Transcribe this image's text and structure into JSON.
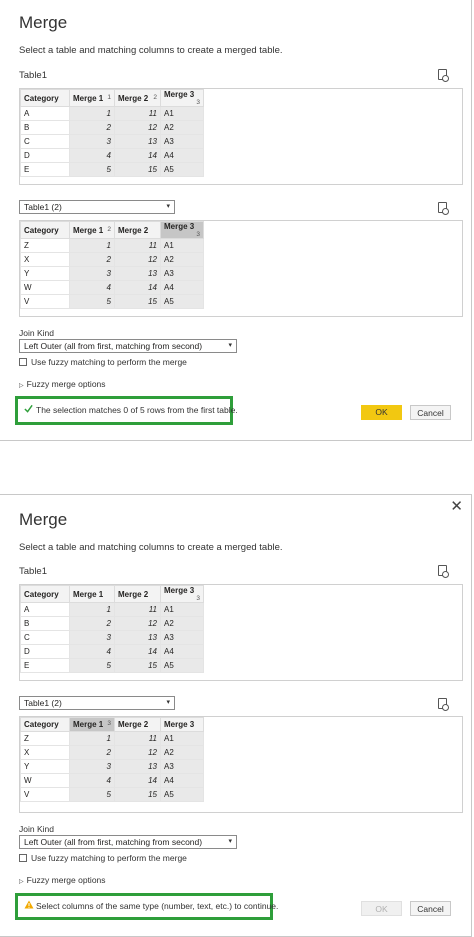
{
  "dialogs": [
    {
      "title": "Merge",
      "description": "Select a table and matching columns to create a merged table.",
      "table1_label": "Table1",
      "table1": {
        "headers": [
          {
            "label": "Category",
            "num": ""
          },
          {
            "label": "Merge 1",
            "num": "1"
          },
          {
            "label": "Merge 2",
            "num": "2"
          },
          {
            "label": "Merge 3",
            "num": "3"
          }
        ],
        "rows": [
          [
            "A",
            "1",
            "11",
            "A1"
          ],
          [
            "B",
            "2",
            "12",
            "A2"
          ],
          [
            "C",
            "3",
            "13",
            "A3"
          ],
          [
            "D",
            "4",
            "14",
            "A4"
          ],
          [
            "E",
            "5",
            "15",
            "A5"
          ]
        ]
      },
      "table2_select": "Table1 (2)",
      "table2": {
        "headers": [
          {
            "label": "Category",
            "num": ""
          },
          {
            "label": "Merge 1",
            "num": "2"
          },
          {
            "label": "Merge 2",
            "num": ""
          },
          {
            "label": "Merge 3",
            "num": "3"
          }
        ],
        "rows": [
          [
            "Z",
            "1",
            "11",
            "A1"
          ],
          [
            "X",
            "2",
            "12",
            "A2"
          ],
          [
            "Y",
            "3",
            "13",
            "A3"
          ],
          [
            "W",
            "4",
            "14",
            "A4"
          ],
          [
            "V",
            "5",
            "15",
            "A5"
          ]
        ]
      },
      "join_kind_label": "Join Kind",
      "join_kind_value": "Left Outer (all from first, matching from second)",
      "fuzzy_checkbox_label": "Use fuzzy matching to perform the merge",
      "fuzzy_options_label": "Fuzzy merge options",
      "status_message": "The selection matches 0 of 5 rows from the first table.",
      "ok_label": "OK",
      "cancel_label": "Cancel"
    },
    {
      "title": "Merge",
      "description": "Select a table and matching columns to create a merged table.",
      "table1_label": "Table1",
      "table1": {
        "headers": [
          {
            "label": "Category",
            "num": ""
          },
          {
            "label": "Merge 1",
            "num": ""
          },
          {
            "label": "Merge 2",
            "num": ""
          },
          {
            "label": "Merge 3",
            "num": "3"
          }
        ],
        "rows": [
          [
            "A",
            "1",
            "11",
            "A1"
          ],
          [
            "B",
            "2",
            "12",
            "A2"
          ],
          [
            "C",
            "3",
            "13",
            "A3"
          ],
          [
            "D",
            "4",
            "14",
            "A4"
          ],
          [
            "E",
            "5",
            "15",
            "A5"
          ]
        ]
      },
      "table2_select": "Table1 (2)",
      "table2": {
        "headers": [
          {
            "label": "Category",
            "num": ""
          },
          {
            "label": "Merge 1",
            "num": "3"
          },
          {
            "label": "Merge 2",
            "num": ""
          },
          {
            "label": "Merge 3",
            "num": ""
          }
        ],
        "rows": [
          [
            "Z",
            "1",
            "11",
            "A1"
          ],
          [
            "X",
            "2",
            "12",
            "A2"
          ],
          [
            "Y",
            "3",
            "13",
            "A3"
          ],
          [
            "W",
            "4",
            "14",
            "A4"
          ],
          [
            "V",
            "5",
            "15",
            "A5"
          ]
        ]
      },
      "join_kind_label": "Join Kind",
      "join_kind_value": "Left Outer (all from first, matching from second)",
      "fuzzy_checkbox_label": "Use fuzzy matching to perform the merge",
      "fuzzy_options_label": "Fuzzy merge options",
      "status_message": "Select columns of the same type (number, text, etc.) to continue.",
      "ok_label": "OK",
      "cancel_label": "Cancel",
      "close_label": "✕"
    }
  ],
  "colors": {
    "ok_button": "#f2c811",
    "highlight_border": "#2e9e3a",
    "selected_header": "#c6c6c6",
    "warning": "#f2a900"
  }
}
